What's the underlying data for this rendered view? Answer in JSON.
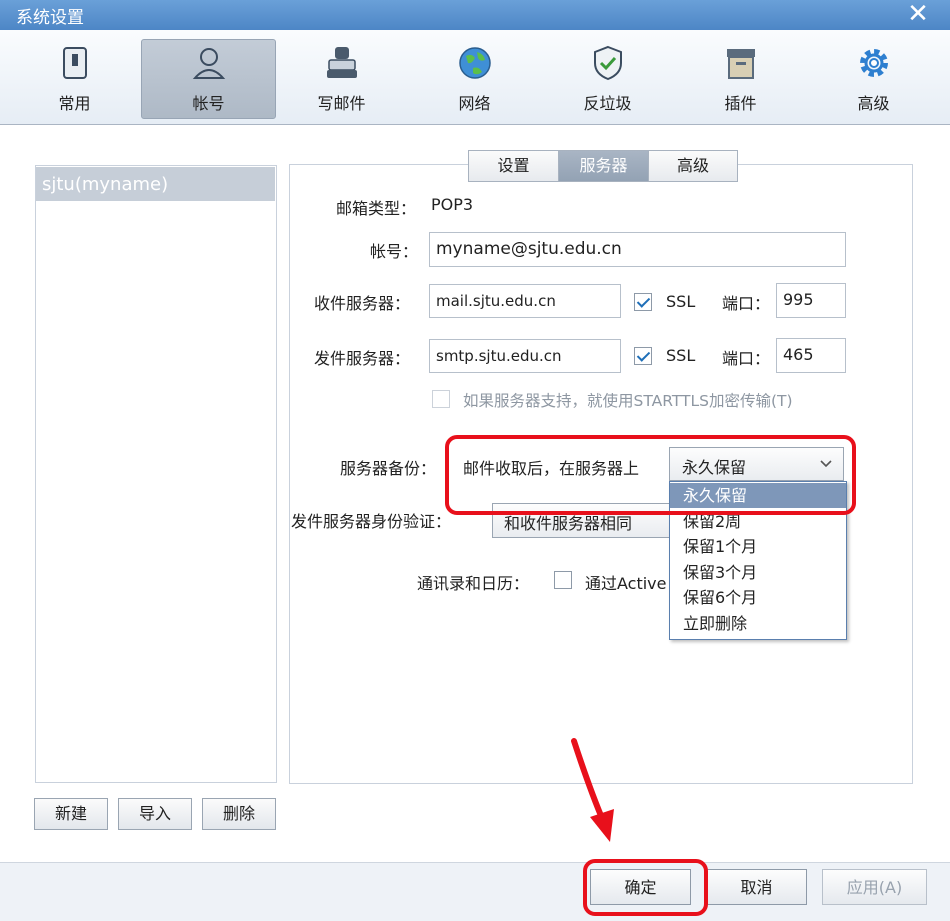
{
  "window": {
    "title": "系统设置",
    "close_glyph": "✕"
  },
  "toolbar": {
    "items": [
      {
        "label": "常用",
        "icon": "general-icon"
      },
      {
        "label": "帐号",
        "icon": "account-icon"
      },
      {
        "label": "写邮件",
        "icon": "compose-icon"
      },
      {
        "label": "网络",
        "icon": "network-icon"
      },
      {
        "label": "反垃圾",
        "icon": "antispam-icon"
      },
      {
        "label": "插件",
        "icon": "plugin-icon"
      },
      {
        "label": "高级",
        "icon": "advanced-icon"
      }
    ],
    "active": "帐号"
  },
  "accounts": {
    "items": [
      "sjtu(myname)"
    ],
    "buttons": {
      "new": "新建",
      "import": "导入",
      "delete": "删除"
    }
  },
  "tabs": [
    {
      "label": "设置"
    },
    {
      "label": "服务器"
    },
    {
      "label": "高级"
    }
  ],
  "form": {
    "mailbox_type_label": "邮箱类型：",
    "mailbox_type_value": "POP3",
    "account_label": "帐号：",
    "account_value": "myname@sjtu.edu.cn",
    "incoming_label": "收件服务器：",
    "incoming_value": "mail.sjtu.edu.cn",
    "incoming_ssl_label": "SSL",
    "incoming_port_label": "端口：",
    "incoming_port_value": "995",
    "outgoing_label": "发件服务器：",
    "outgoing_value": "smtp.sjtu.edu.cn",
    "outgoing_ssl_label": "SSL",
    "outgoing_port_label": "端口：",
    "outgoing_port_value": "465",
    "starttls_label": "如果服务器支持，就使用STARTTLS加密传输(T)",
    "backup_label": "服务器备份：",
    "backup_prefix": "邮件收取后，在服务器上",
    "backup_selected": "永久保留",
    "auth_label": "发件服务器身份验证：",
    "auth_value": "和收件服务器相同",
    "contacts_label": "通讯录和日历：",
    "contacts_option": "通过Active"
  },
  "dropdown_options": [
    "永久保留",
    "保留2周",
    "保留1个月",
    "保留3个月",
    "保留6个月",
    "立即删除"
  ],
  "footer": {
    "ok": "确定",
    "cancel": "取消",
    "apply": "应用(A)"
  },
  "colors": {
    "highlight": "#e8101b",
    "accent": "#4d86c6"
  }
}
